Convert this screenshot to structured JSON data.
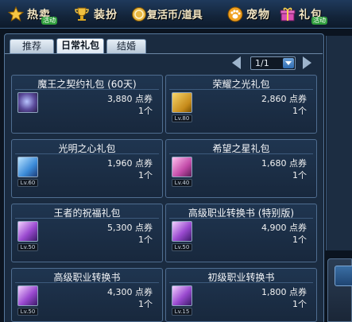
{
  "topbar": {
    "items": [
      {
        "label": "热卖",
        "badge": "活动",
        "icon": "star-icon"
      },
      {
        "label": "装扮",
        "badge": "",
        "icon": "trophy-icon"
      },
      {
        "label": "复活币/道具",
        "badge": "",
        "icon": "coin-icon"
      },
      {
        "label": "宠物",
        "badge": "",
        "icon": "paw-icon"
      },
      {
        "label": "礼包",
        "badge": "活动",
        "icon": "gift-icon"
      }
    ]
  },
  "tabs": [
    {
      "label": "推荐",
      "active": false
    },
    {
      "label": "日常礼包",
      "active": true
    },
    {
      "label": "结婚",
      "active": false
    }
  ],
  "pager": {
    "value": "1/1"
  },
  "items": [
    {
      "name": "魔王之契约礼包 (60天)",
      "price": "3,880 点券",
      "qty": "1个",
      "level": "",
      "icon": "demon-pack-icon"
    },
    {
      "name": "荣耀之光礼包",
      "price": "2,860 点券",
      "qty": "1个",
      "level": "Lv.80",
      "icon": "gold-box-icon"
    },
    {
      "name": "光明之心礼包",
      "price": "1,960 点券",
      "qty": "1个",
      "level": "Lv.60",
      "icon": "blue-box-icon"
    },
    {
      "name": "希望之星礼包",
      "price": "1,680 点券",
      "qty": "1个",
      "level": "Lv.40",
      "icon": "pink-box-icon"
    },
    {
      "name": "王者的祝福礼包",
      "price": "5,300 点券",
      "qty": "1个",
      "level": "Lv.50",
      "icon": "purple-book-icon"
    },
    {
      "name": "高级职业转换书 (特别版)",
      "price": "4,900 点券",
      "qty": "1个",
      "level": "Lv.50",
      "icon": "purple-book-icon"
    },
    {
      "name": "高级职业转换书",
      "price": "4,300 点券",
      "qty": "1个",
      "level": "Lv.50",
      "icon": "purple-book-icon"
    },
    {
      "name": "初级职业转换书",
      "price": "1,800 点券",
      "qty": "1个",
      "level": "Lv.15",
      "icon": "purple-book-icon"
    }
  ],
  "colors": {
    "accent": "#f2e5c3",
    "panel": "#1a2b40",
    "badge": "#2f9e3c"
  }
}
